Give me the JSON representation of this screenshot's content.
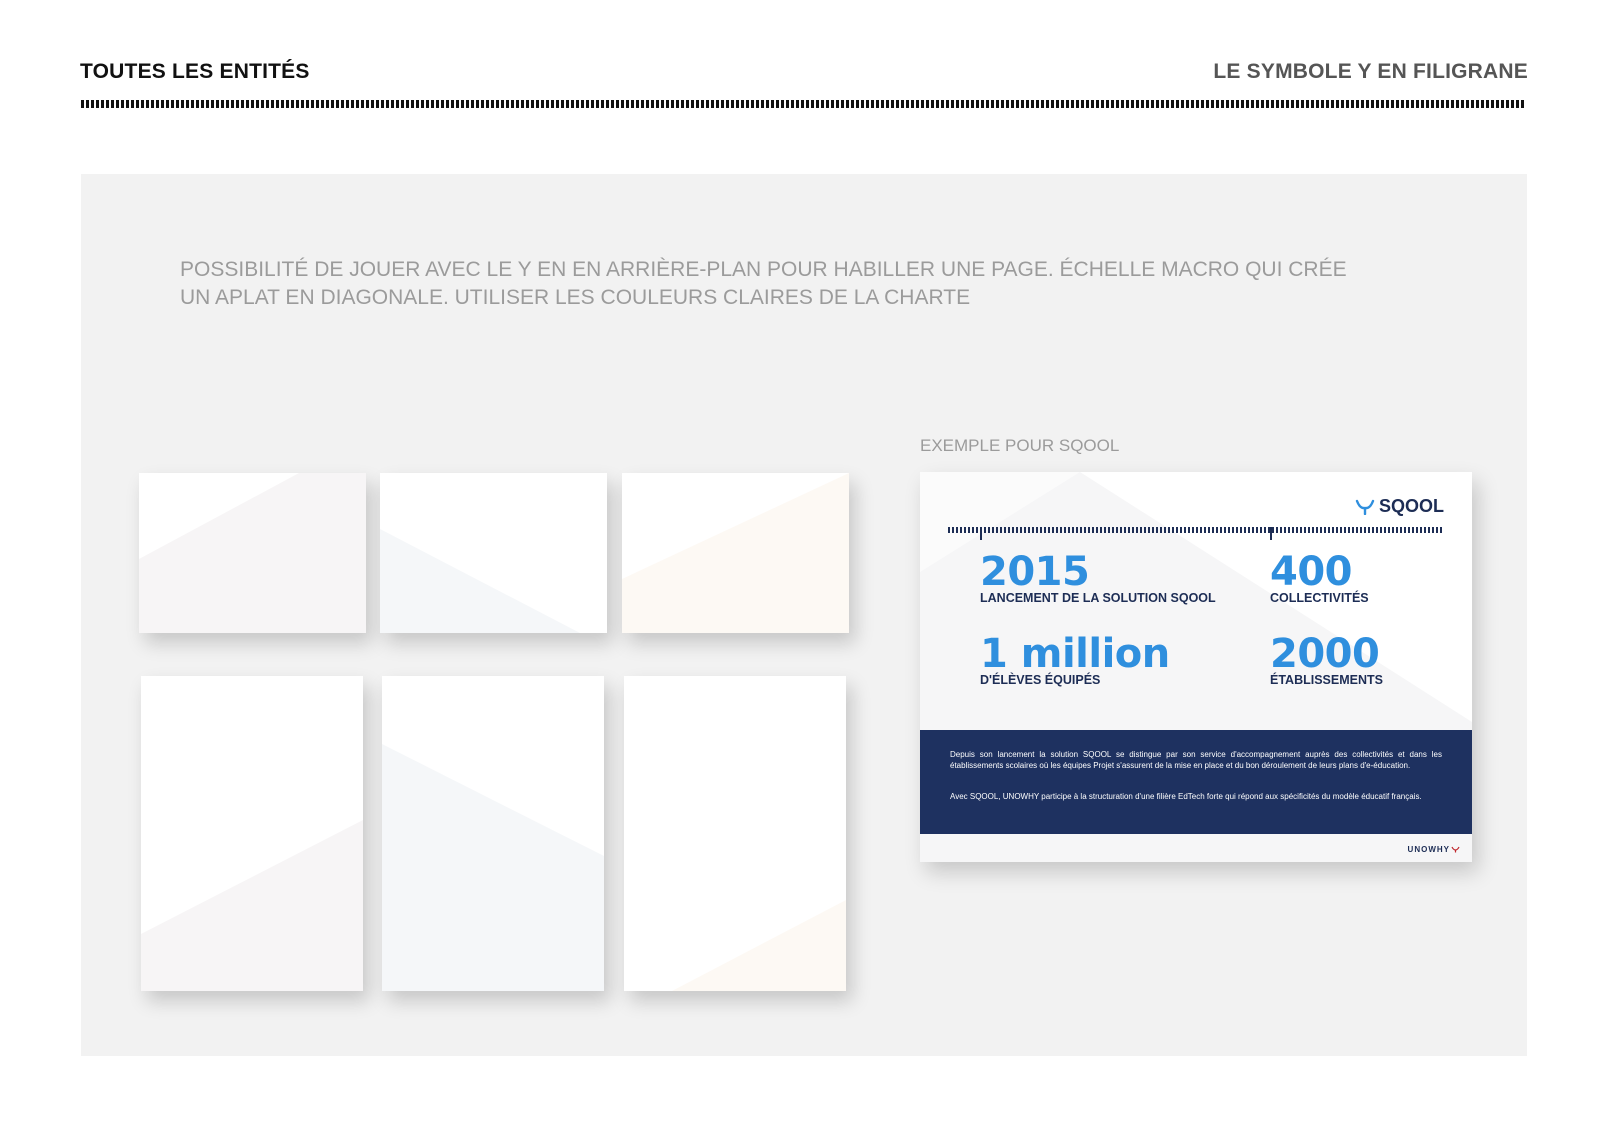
{
  "header": {
    "left_title": "TOUTES LES ENTITÉS",
    "right_title": "LE SYMBOLE Y EN FILIGRANE"
  },
  "intro_text": "POSSIBILITÉ DE JOUER AVEC LE Y EN  EN ARRIÈRE-PLAN POUR HABILLER UNE PAGE. ÉCHELLE MACRO QUI CRÉE UN APLAT EN DIAGONALE. UTILISER LES COULEURS CLAIRES DE LA CHARTE",
  "tint_colors": {
    "pink": "#f7f5f6",
    "blue": "#f5f7f9",
    "peach": "#fdf9f4"
  },
  "example": {
    "label": "EXEMPLE POUR SQOOL",
    "brand": "SQOOL",
    "brand_color": "#1d2d55",
    "number_color": "#2f8fde",
    "stats": [
      {
        "number": "2015",
        "label": "LANCEMENT DE LA SOLUTION SQOOL"
      },
      {
        "number": "400",
        "label": "COLLECTIVITÉS"
      },
      {
        "number": "1 million",
        "label": "D'ÉLÈVES ÉQUIPÉS"
      },
      {
        "number": "2000",
        "label": "ÉTABLISSEMENTS"
      }
    ],
    "paragraphs": [
      "Depuis son lancement la solution SQOOL se distingue par son service d'accompagnement auprès des collectivités et dans les établissements scolaires où les équipes Projet s'assurent de la mise en place et du bon déroulement de leurs plans d'e-éducation.",
      "Avec SQOOL, UNOWHY participe à la structuration d'une filière EdTech forte qui répond aux spécificités du modèle éducatif français."
    ],
    "footer_brand": "UNOWHY"
  }
}
